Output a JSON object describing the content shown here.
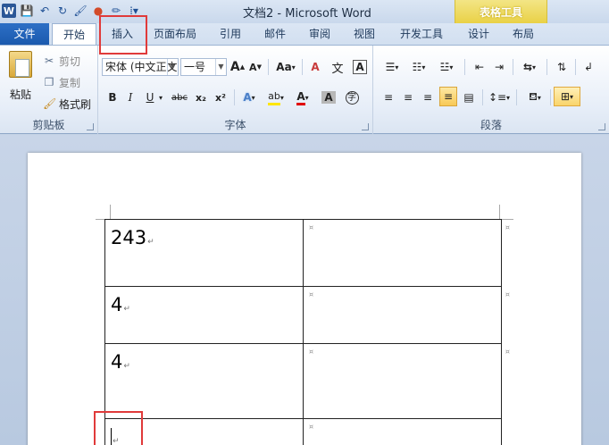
{
  "window": {
    "title": "文档2 - Microsoft Word",
    "context_group": "表格工具",
    "app_icon": "W"
  },
  "qat": {
    "save": "💾",
    "undo": "↶",
    "repeat": "↻",
    "format": "🖌",
    "ball": "●",
    "draw": "✏",
    "more": "⁞▾"
  },
  "tabs": [
    {
      "label": "文件"
    },
    {
      "label": "开始"
    },
    {
      "label": "插入"
    },
    {
      "label": "页面布局"
    },
    {
      "label": "引用"
    },
    {
      "label": "邮件"
    },
    {
      "label": "审阅"
    },
    {
      "label": "视图"
    },
    {
      "label": "开发工具"
    },
    {
      "label": "设计"
    },
    {
      "label": "布局"
    }
  ],
  "clipboard": {
    "paste": "粘贴",
    "cut": "剪切",
    "copy": "复制",
    "format_painter": "格式刷",
    "label": "剪贴板"
  },
  "font": {
    "name": "宋体 (中文正文)",
    "size": "一号",
    "grow": "A",
    "shrink": "A",
    "change_case": "Aa",
    "clear": "A",
    "phonetic": "文",
    "border": "A",
    "bold": "B",
    "italic": "I",
    "underline": "U",
    "strike": "abc",
    "sub": "x₂",
    "sup": "x²",
    "effects": "A",
    "highlight": "ab",
    "color": "A",
    "shading": "A",
    "enclose": "字",
    "label": "字体"
  },
  "paragraph": {
    "label": "段落"
  },
  "table": {
    "rows": [
      {
        "c1": "243",
        "c2": ""
      },
      {
        "c1": "4",
        "c2": ""
      },
      {
        "c1": "4",
        "c2": ""
      },
      {
        "c1": "",
        "c2": ""
      }
    ]
  },
  "colors": {
    "file_tab": "#1b5aae",
    "context": "#e9d146",
    "highlight": "#e03a3a"
  }
}
